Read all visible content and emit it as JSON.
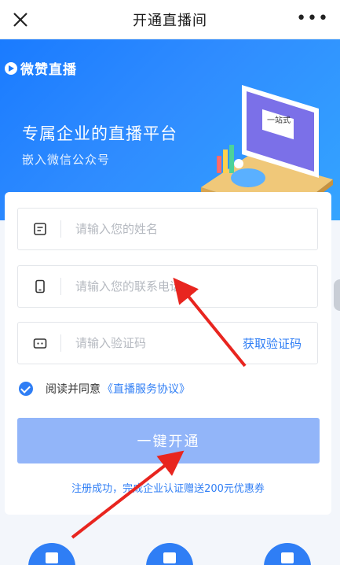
{
  "topbar": {
    "title": "开通直播间",
    "more": "•••"
  },
  "hero": {
    "brand": "微赞直播",
    "headline": "专属企业的直播平台",
    "subline": "嵌入微信公众号",
    "illustration_badge": "一站式"
  },
  "form": {
    "name_placeholder": "请输入您的姓名",
    "phone_placeholder": "请输入您的联系电话",
    "code_placeholder": "请输入验证码",
    "get_code_label": "获取验证码",
    "agree_text": "阅读并同意",
    "agreement_link": "《直播服务协议》",
    "submit_label": "一键开通",
    "promo_text": "注册成功，完成企业认证赠送200元优惠券"
  },
  "colors": {
    "accent": "#2f7ef5",
    "hero_start": "#1a7bff",
    "submit_disabled": "#92b5f9",
    "annotation_arrow": "#e8251f"
  }
}
